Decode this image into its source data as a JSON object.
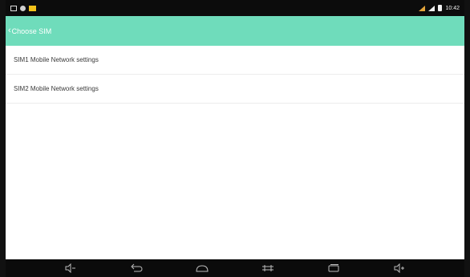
{
  "statusbar": {
    "left_icons": [
      "screenshot-icon",
      "gear-icon",
      "warning-icon"
    ],
    "right_icons": [
      "signal-icon",
      "signal-icon",
      "battery-icon"
    ],
    "time": "10:42"
  },
  "header": {
    "back_icon": "chevron-left-icon",
    "title": "Choose SIM",
    "color": "#6fdcbb"
  },
  "list": {
    "items": [
      {
        "label": "SIM1 Mobile Network settings"
      },
      {
        "label": "SIM2 Mobile Network settings"
      }
    ]
  },
  "navbar": {
    "buttons": [
      "volume-down-icon",
      "back-icon",
      "home-icon",
      "screenshot-capture-icon",
      "recent-apps-icon",
      "volume-up-icon"
    ]
  }
}
